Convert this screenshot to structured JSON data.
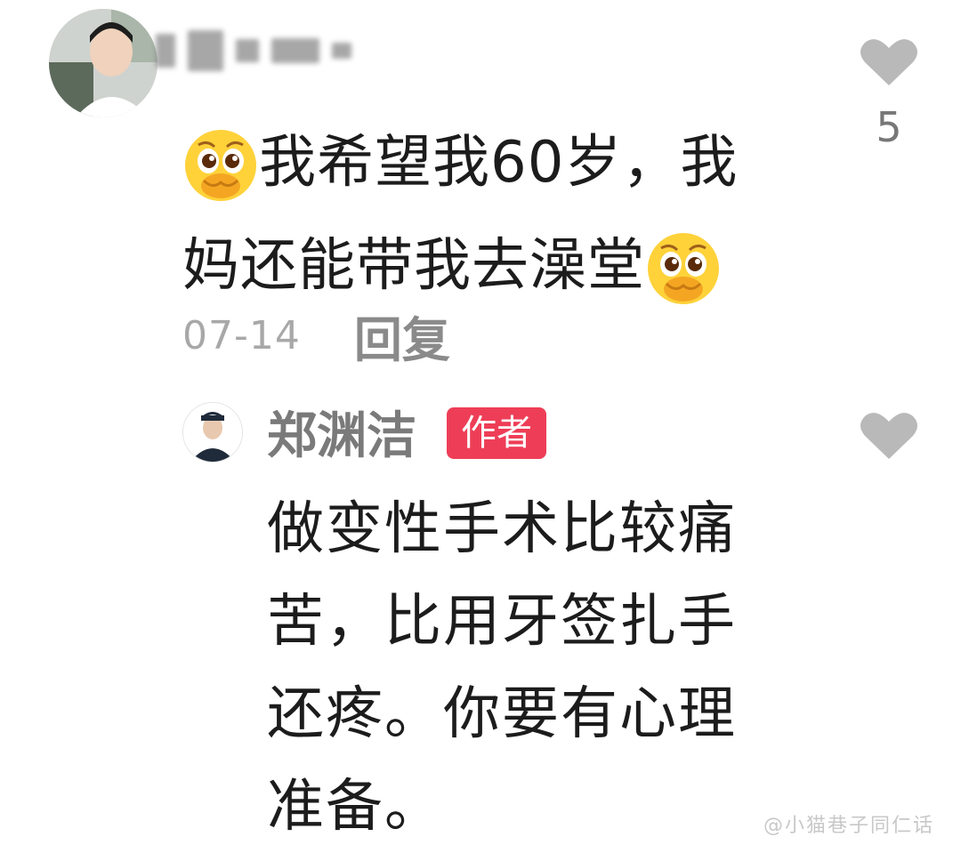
{
  "comment": {
    "user": {
      "name_redacted": true
    },
    "text_line1": "我希望我60岁，我",
    "text_line2": "妈还能带我去澡堂",
    "date": "07-14",
    "reply_label": "回复",
    "like_count": "5",
    "emoji_icon": "pleading-face-icon"
  },
  "reply": {
    "user_name": "郑渊洁",
    "badge": "作者",
    "text": [
      "做变性手术比较痛",
      "苦，比用牙签扎手",
      "还疼。你要有心理",
      "准备。"
    ]
  },
  "watermark": "@小猫巷子同仁话",
  "colors": {
    "badge": "#ee3e57",
    "heart": "#b9b9b9",
    "date": "#a8a8a8",
    "reply_label": "#8a8a8a"
  }
}
